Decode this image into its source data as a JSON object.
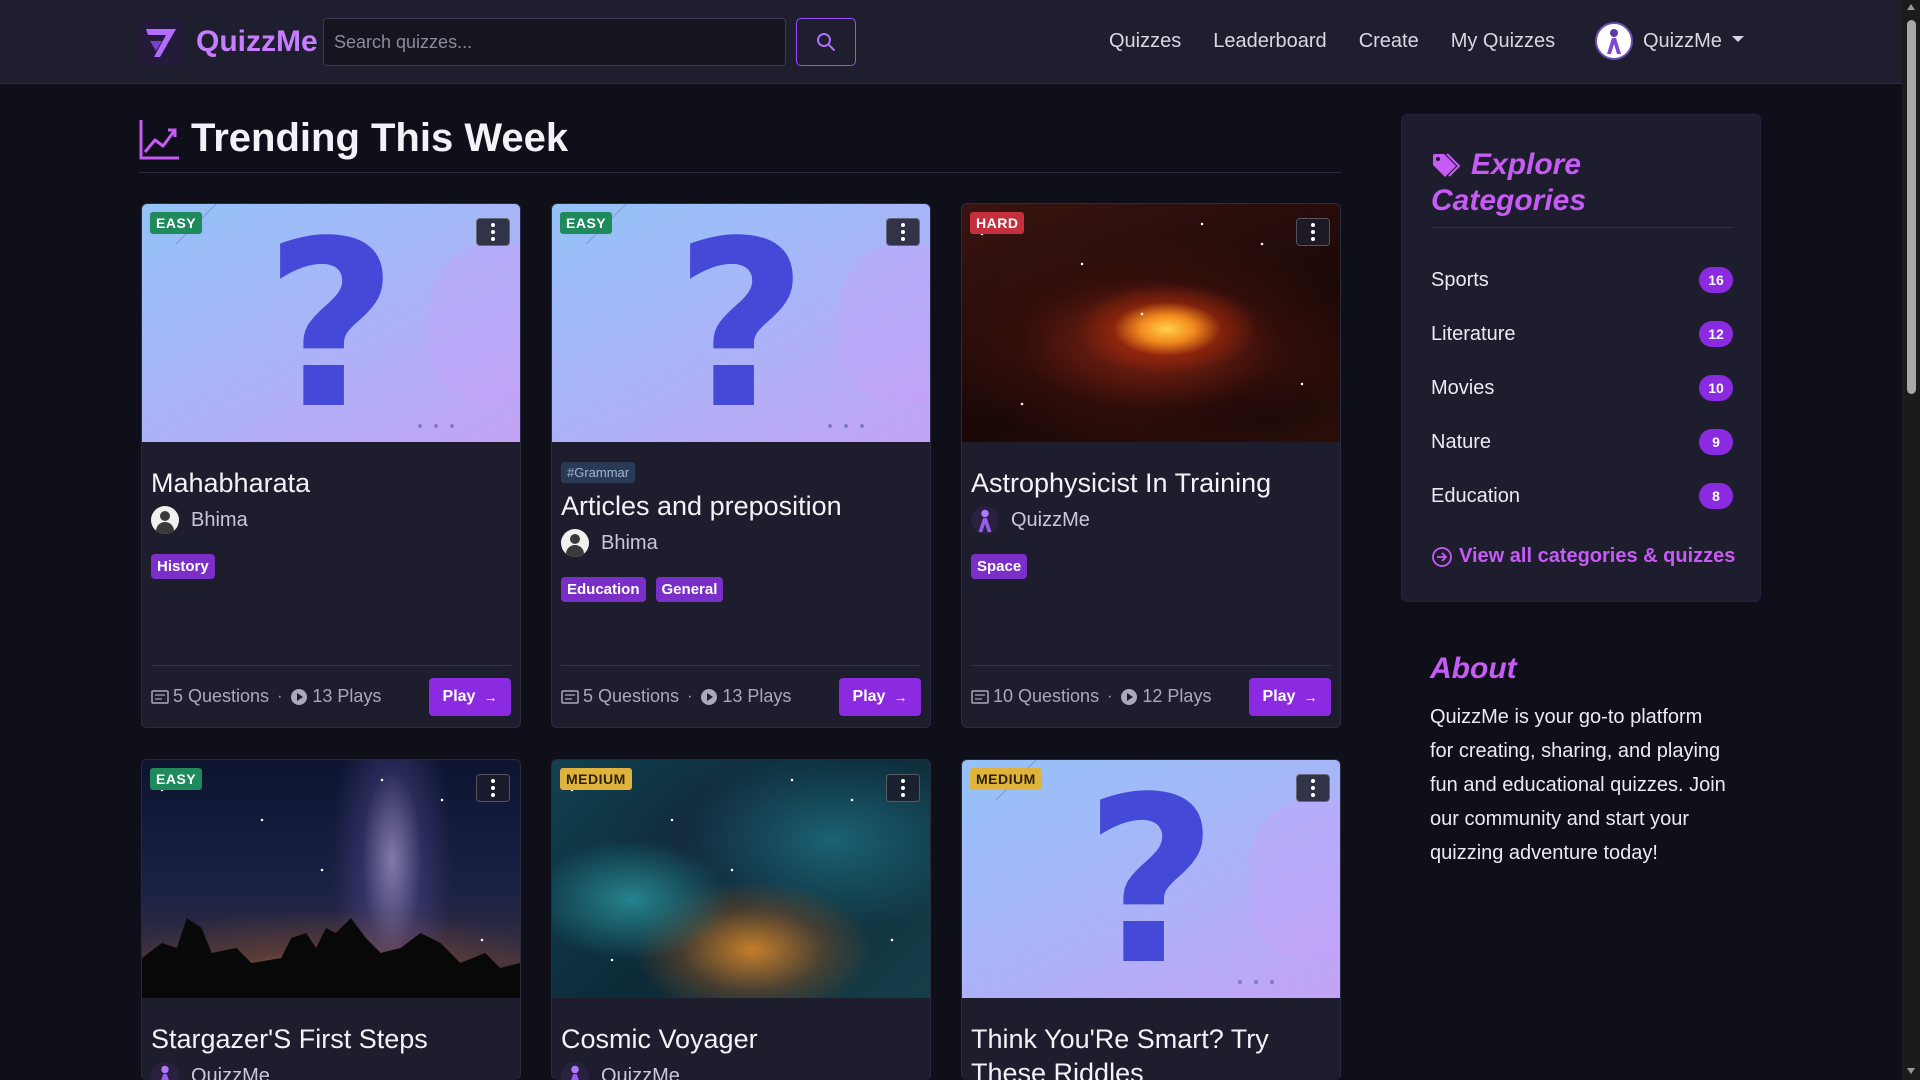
{
  "nav": {
    "brand": "QuizzMe",
    "search_placeholder": "Search quizzes...",
    "links": [
      "Quizzes",
      "Leaderboard",
      "Create",
      "My Quizzes"
    ],
    "user_name": "QuizzMe"
  },
  "section": {
    "title": "Trending This Week"
  },
  "cards": [
    {
      "difficulty": "EASY",
      "title": "Mahabharata",
      "author": "Bhima",
      "tags": [
        "History"
      ],
      "questions": "5 Questions",
      "plays": "13 Plays",
      "play": "Play"
    },
    {
      "difficulty": "EASY",
      "topic_tag": "#Grammar",
      "title": "Articles and preposition",
      "author": "Bhima",
      "tags": [
        "Education",
        "General"
      ],
      "questions": "5 Questions",
      "plays": "13 Plays",
      "play": "Play"
    },
    {
      "difficulty": "HARD",
      "title": "Astrophysicist In Training",
      "author": "QuizzMe",
      "tags": [
        "Space"
      ],
      "questions": "10 Questions",
      "plays": "12 Plays",
      "play": "Play"
    },
    {
      "difficulty": "EASY",
      "title": "Stargazer'S First Steps",
      "author": "QuizzMe"
    },
    {
      "difficulty": "MEDIUM",
      "title": "Cosmic Voyager",
      "author": "QuizzMe"
    },
    {
      "difficulty": "MEDIUM",
      "title": "Think You'Re Smart? Try These Riddles"
    }
  ],
  "categories": {
    "title": "Explore Categories",
    "items": [
      {
        "name": "Sports",
        "count": "16"
      },
      {
        "name": "Literature",
        "count": "12"
      },
      {
        "name": "Movies",
        "count": "10"
      },
      {
        "name": "Nature",
        "count": "9"
      },
      {
        "name": "Education",
        "count": "8"
      }
    ],
    "view_all": "View all categories & quizzes"
  },
  "about": {
    "title": "About",
    "text": "QuizzMe is your go-to platform for creating, sharing, and playing fun and educational quizzes. Join our community and start your quizzing adventure today!"
  },
  "colors": {
    "accent": "#8a2be2",
    "heading_accent": "#c65bf5",
    "background": "#0f0f19",
    "card": "#1d1d2e"
  }
}
